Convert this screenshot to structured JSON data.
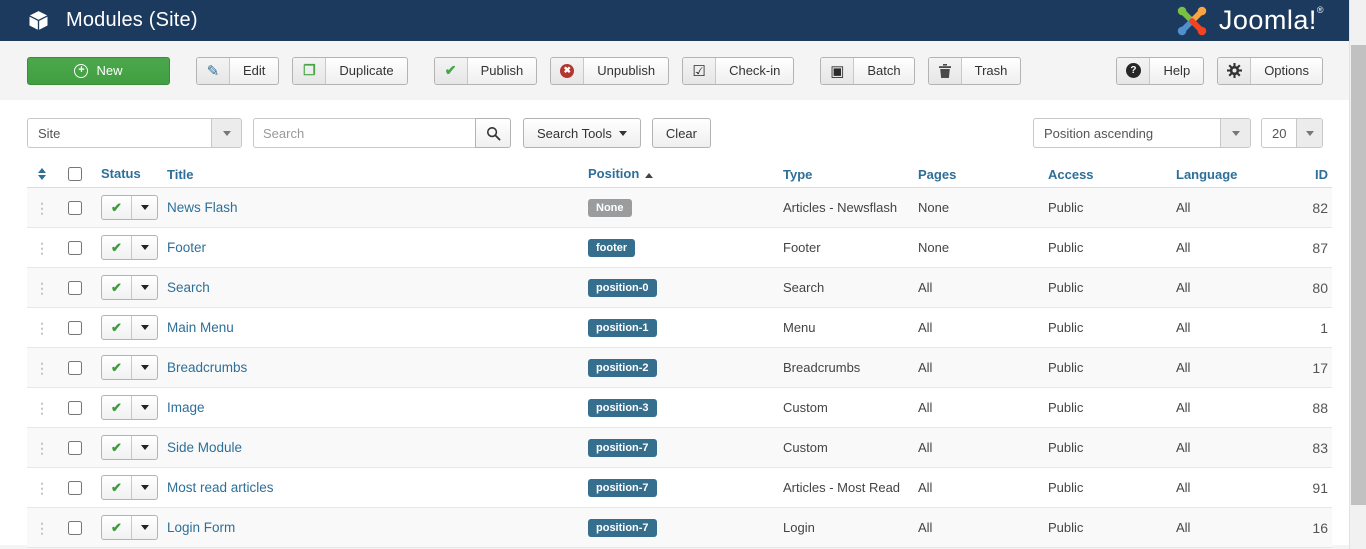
{
  "titlebar": {
    "title": "Modules (Site)",
    "logo_text": "Joomla!",
    "logo_reg": "®"
  },
  "toolbar": {
    "new_label": "New",
    "buttons": [
      {
        "label": "Edit",
        "icon": "edit-icon"
      },
      {
        "label": "Duplicate",
        "icon": "duplicate-icon"
      },
      {
        "label": "Publish",
        "icon": "publish-check-icon"
      },
      {
        "label": "Unpublish",
        "icon": "unpublish-icon"
      },
      {
        "label": "Check-in",
        "icon": "checkin-icon"
      },
      {
        "label": "Batch",
        "icon": "batch-icon"
      },
      {
        "label": "Trash",
        "icon": "trash-icon"
      }
    ],
    "help_label": "Help",
    "options_label": "Options"
  },
  "filters": {
    "site_select_value": "Site",
    "search_placeholder": "Search",
    "search_tools_label": "Search Tools",
    "clear_label": "Clear",
    "sort_select_value": "Position ascending",
    "limit_select_value": "20"
  },
  "table": {
    "headers": {
      "status": "Status",
      "title": "Title",
      "position": "Position",
      "type": "Type",
      "pages": "Pages",
      "access": "Access",
      "language": "Language",
      "id": "ID"
    },
    "rows": [
      {
        "title": "News Flash",
        "position": "None",
        "badge": "muted",
        "type": "Articles - Newsflash",
        "pages": "None",
        "access": "Public",
        "language": "All",
        "id": "82"
      },
      {
        "title": "Footer",
        "position": "footer",
        "badge": "info",
        "type": "Footer",
        "pages": "None",
        "access": "Public",
        "language": "All",
        "id": "87"
      },
      {
        "title": "Search",
        "position": "position-0",
        "badge": "info",
        "type": "Search",
        "pages": "All",
        "access": "Public",
        "language": "All",
        "id": "80"
      },
      {
        "title": "Main Menu",
        "position": "position-1",
        "badge": "info",
        "type": "Menu",
        "pages": "All",
        "access": "Public",
        "language": "All",
        "id": "1"
      },
      {
        "title": "Breadcrumbs",
        "position": "position-2",
        "badge": "info",
        "type": "Breadcrumbs",
        "pages": "All",
        "access": "Public",
        "language": "All",
        "id": "17"
      },
      {
        "title": "Image",
        "position": "position-3",
        "badge": "info",
        "type": "Custom",
        "pages": "All",
        "access": "Public",
        "language": "All",
        "id": "88"
      },
      {
        "title": "Side Module",
        "position": "position-7",
        "badge": "info",
        "type": "Custom",
        "pages": "All",
        "access": "Public",
        "language": "All",
        "id": "83"
      },
      {
        "title": "Most read articles",
        "position": "position-7",
        "badge": "info",
        "type": "Articles - Most Read",
        "pages": "All",
        "access": "Public",
        "language": "All",
        "id": "91"
      },
      {
        "title": "Login Form",
        "position": "position-7",
        "badge": "info",
        "type": "Login",
        "pages": "All",
        "access": "Public",
        "language": "All",
        "id": "16"
      }
    ]
  },
  "colors": {
    "header_bg": "#1c3a5e",
    "accent_green": "#46a546",
    "link": "#2d6f99",
    "badge_info": "#366e8d",
    "badge_muted": "#9a9c9e"
  }
}
